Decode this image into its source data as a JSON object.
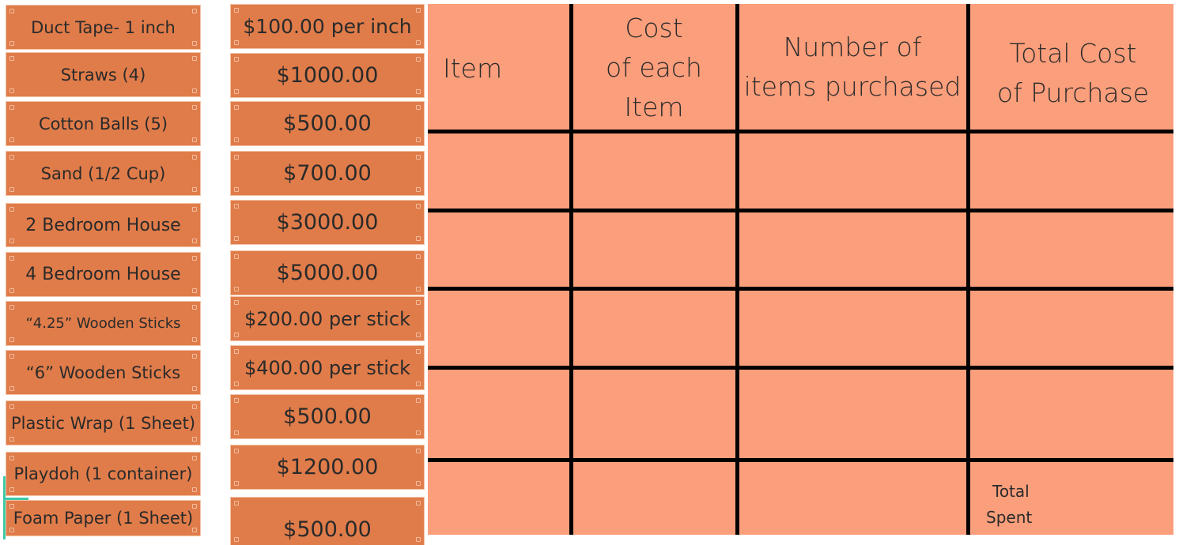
{
  "items": [
    {
      "label": "Duct Tape- 1 inch"
    },
    {
      "label": "Straws (4)"
    },
    {
      "label": "Cotton Balls (5)"
    },
    {
      "label": "Sand (1/2 Cup)"
    },
    {
      "label": "2 Bedroom House"
    },
    {
      "label": "4 Bedroom House"
    },
    {
      "label": "“4.25” Wooden Sticks"
    },
    {
      "label": "“6” Wooden Sticks"
    },
    {
      "label": "Plastic Wrap (1 Sheet)"
    },
    {
      "label": "Playdoh (1 container)"
    },
    {
      "label": "Foam Paper (1 Sheet)"
    }
  ],
  "prices": [
    {
      "label": "$100.00 per inch"
    },
    {
      "label": "$1000.00"
    },
    {
      "label": "$500.00"
    },
    {
      "label": "$700.00"
    },
    {
      "label": "$3000.00"
    },
    {
      "label": "$5000.00"
    },
    {
      "label": "$200.00 per stick"
    },
    {
      "label": "$400.00 per stick"
    },
    {
      "label": "$500.00"
    },
    {
      "label": "$1200.00"
    },
    {
      "label": "$500.00"
    }
  ],
  "table": {
    "headers": [
      {
        "lines": [
          "Item"
        ]
      },
      {
        "lines": [
          "Cost",
          "of each",
          "Item"
        ]
      },
      {
        "lines": [
          "Number of",
          "items purchased"
        ]
      },
      {
        "lines": [
          "Total Cost",
          "of Purchase"
        ]
      }
    ],
    "rows": [
      [
        "",
        "",
        "",
        ""
      ],
      [
        "",
        "",
        "",
        ""
      ],
      [
        "",
        "",
        "",
        ""
      ],
      [
        "",
        "",
        "",
        ""
      ],
      [
        "",
        "",
        "",
        ""
      ]
    ],
    "total_label": [
      "Total",
      "Spent"
    ]
  },
  "colors": {
    "card": "#e07c4a",
    "table": "#fb9e7b",
    "grid": "#000000",
    "accent": "#3ec9a7"
  }
}
